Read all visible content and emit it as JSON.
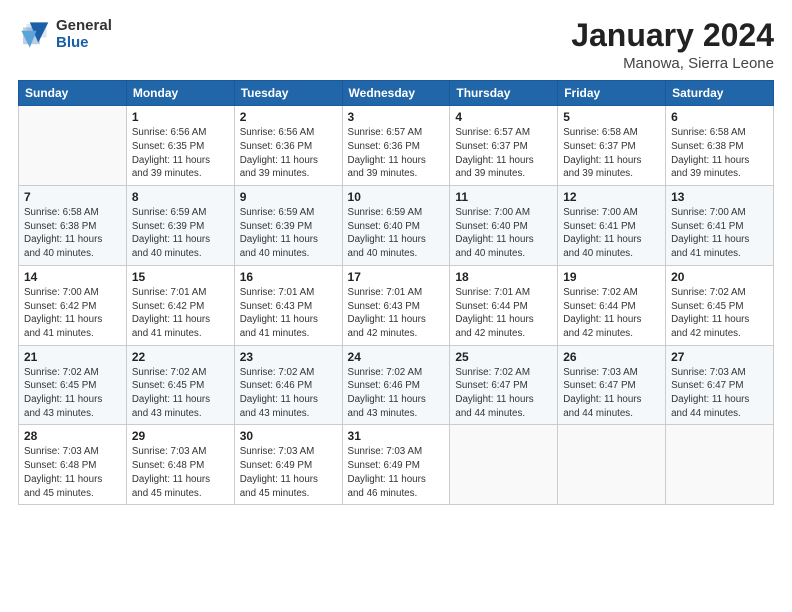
{
  "logo": {
    "general": "General",
    "blue": "Blue"
  },
  "header": {
    "month": "January 2024",
    "location": "Manowa, Sierra Leone"
  },
  "weekdays": [
    "Sunday",
    "Monday",
    "Tuesday",
    "Wednesday",
    "Thursday",
    "Friday",
    "Saturday"
  ],
  "weeks": [
    [
      {
        "day": "",
        "info": ""
      },
      {
        "day": "1",
        "info": "Sunrise: 6:56 AM\nSunset: 6:35 PM\nDaylight: 11 hours\nand 39 minutes."
      },
      {
        "day": "2",
        "info": "Sunrise: 6:56 AM\nSunset: 6:36 PM\nDaylight: 11 hours\nand 39 minutes."
      },
      {
        "day": "3",
        "info": "Sunrise: 6:57 AM\nSunset: 6:36 PM\nDaylight: 11 hours\nand 39 minutes."
      },
      {
        "day": "4",
        "info": "Sunrise: 6:57 AM\nSunset: 6:37 PM\nDaylight: 11 hours\nand 39 minutes."
      },
      {
        "day": "5",
        "info": "Sunrise: 6:58 AM\nSunset: 6:37 PM\nDaylight: 11 hours\nand 39 minutes."
      },
      {
        "day": "6",
        "info": "Sunrise: 6:58 AM\nSunset: 6:38 PM\nDaylight: 11 hours\nand 39 minutes."
      }
    ],
    [
      {
        "day": "7",
        "info": "Sunrise: 6:58 AM\nSunset: 6:38 PM\nDaylight: 11 hours\nand 40 minutes."
      },
      {
        "day": "8",
        "info": "Sunrise: 6:59 AM\nSunset: 6:39 PM\nDaylight: 11 hours\nand 40 minutes."
      },
      {
        "day": "9",
        "info": "Sunrise: 6:59 AM\nSunset: 6:39 PM\nDaylight: 11 hours\nand 40 minutes."
      },
      {
        "day": "10",
        "info": "Sunrise: 6:59 AM\nSunset: 6:40 PM\nDaylight: 11 hours\nand 40 minutes."
      },
      {
        "day": "11",
        "info": "Sunrise: 7:00 AM\nSunset: 6:40 PM\nDaylight: 11 hours\nand 40 minutes."
      },
      {
        "day": "12",
        "info": "Sunrise: 7:00 AM\nSunset: 6:41 PM\nDaylight: 11 hours\nand 40 minutes."
      },
      {
        "day": "13",
        "info": "Sunrise: 7:00 AM\nSunset: 6:41 PM\nDaylight: 11 hours\nand 41 minutes."
      }
    ],
    [
      {
        "day": "14",
        "info": "Sunrise: 7:00 AM\nSunset: 6:42 PM\nDaylight: 11 hours\nand 41 minutes."
      },
      {
        "day": "15",
        "info": "Sunrise: 7:01 AM\nSunset: 6:42 PM\nDaylight: 11 hours\nand 41 minutes."
      },
      {
        "day": "16",
        "info": "Sunrise: 7:01 AM\nSunset: 6:43 PM\nDaylight: 11 hours\nand 41 minutes."
      },
      {
        "day": "17",
        "info": "Sunrise: 7:01 AM\nSunset: 6:43 PM\nDaylight: 11 hours\nand 42 minutes."
      },
      {
        "day": "18",
        "info": "Sunrise: 7:01 AM\nSunset: 6:44 PM\nDaylight: 11 hours\nand 42 minutes."
      },
      {
        "day": "19",
        "info": "Sunrise: 7:02 AM\nSunset: 6:44 PM\nDaylight: 11 hours\nand 42 minutes."
      },
      {
        "day": "20",
        "info": "Sunrise: 7:02 AM\nSunset: 6:45 PM\nDaylight: 11 hours\nand 42 minutes."
      }
    ],
    [
      {
        "day": "21",
        "info": "Sunrise: 7:02 AM\nSunset: 6:45 PM\nDaylight: 11 hours\nand 43 minutes."
      },
      {
        "day": "22",
        "info": "Sunrise: 7:02 AM\nSunset: 6:45 PM\nDaylight: 11 hours\nand 43 minutes."
      },
      {
        "day": "23",
        "info": "Sunrise: 7:02 AM\nSunset: 6:46 PM\nDaylight: 11 hours\nand 43 minutes."
      },
      {
        "day": "24",
        "info": "Sunrise: 7:02 AM\nSunset: 6:46 PM\nDaylight: 11 hours\nand 43 minutes."
      },
      {
        "day": "25",
        "info": "Sunrise: 7:02 AM\nSunset: 6:47 PM\nDaylight: 11 hours\nand 44 minutes."
      },
      {
        "day": "26",
        "info": "Sunrise: 7:03 AM\nSunset: 6:47 PM\nDaylight: 11 hours\nand 44 minutes."
      },
      {
        "day": "27",
        "info": "Sunrise: 7:03 AM\nSunset: 6:47 PM\nDaylight: 11 hours\nand 44 minutes."
      }
    ],
    [
      {
        "day": "28",
        "info": "Sunrise: 7:03 AM\nSunset: 6:48 PM\nDaylight: 11 hours\nand 45 minutes."
      },
      {
        "day": "29",
        "info": "Sunrise: 7:03 AM\nSunset: 6:48 PM\nDaylight: 11 hours\nand 45 minutes."
      },
      {
        "day": "30",
        "info": "Sunrise: 7:03 AM\nSunset: 6:49 PM\nDaylight: 11 hours\nand 45 minutes."
      },
      {
        "day": "31",
        "info": "Sunrise: 7:03 AM\nSunset: 6:49 PM\nDaylight: 11 hours\nand 46 minutes."
      },
      {
        "day": "",
        "info": ""
      },
      {
        "day": "",
        "info": ""
      },
      {
        "day": "",
        "info": ""
      }
    ]
  ]
}
